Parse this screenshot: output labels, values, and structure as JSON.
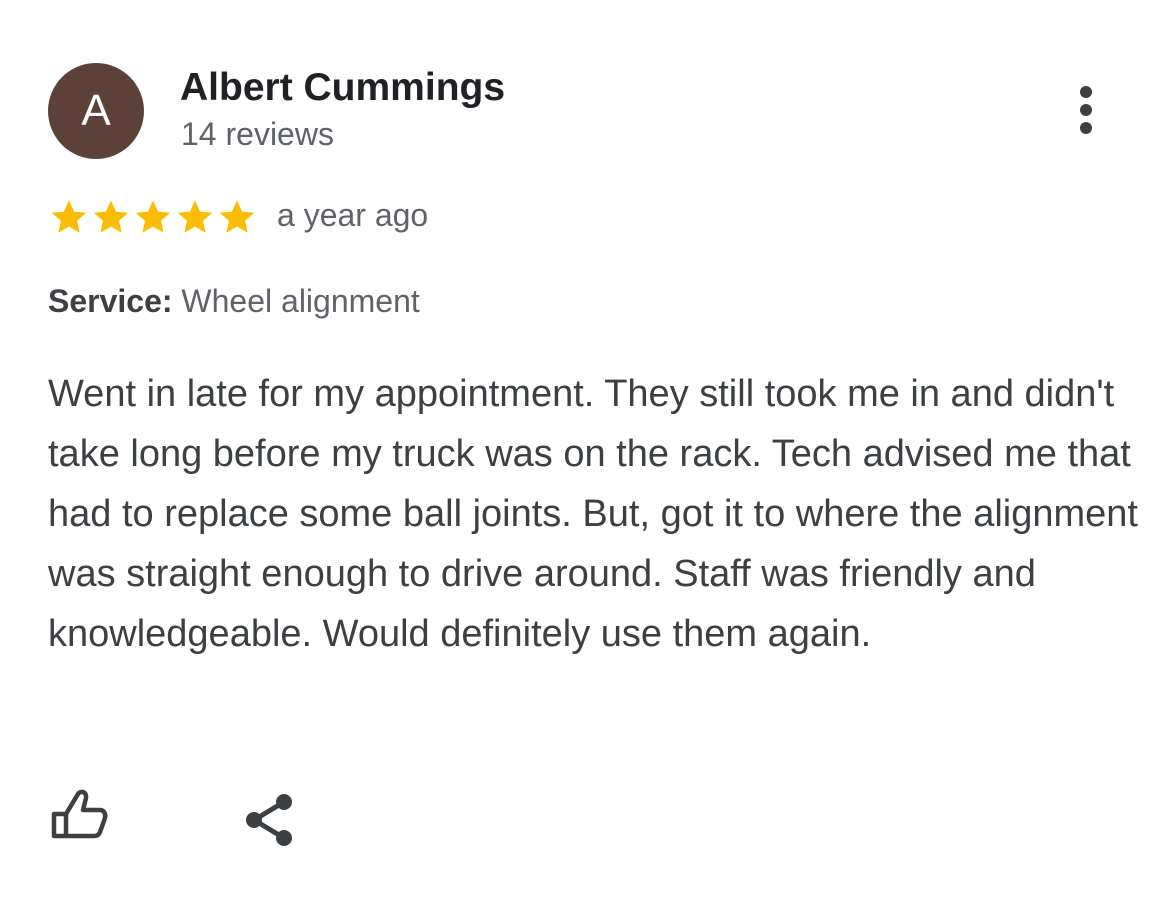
{
  "colors": {
    "avatar_bg": "#5d4037",
    "star": "#fbbc04",
    "text_primary": "#202124",
    "text_secondary": "#5f6368",
    "icon": "#3c4043"
  },
  "review": {
    "author": {
      "initial": "A",
      "name": "Albert Cummings",
      "review_count": "14 reviews"
    },
    "rating": 5,
    "max_rating": 5,
    "time_ago": "a year ago",
    "service_label": "Service:",
    "service_value": "Wheel alignment",
    "text": "Went in late for my appointment. They still took me in and didn't take long before my truck was on the rack. Tech advised me that had to replace some ball joints. But, got it to where the alignment was straight enough to drive around. Staff was friendly and knowledgeable. Would definitely use them again."
  },
  "icons": {
    "more": "more-vert-icon",
    "like": "thumbs-up-icon",
    "share": "share-icon",
    "star": "star-icon"
  }
}
